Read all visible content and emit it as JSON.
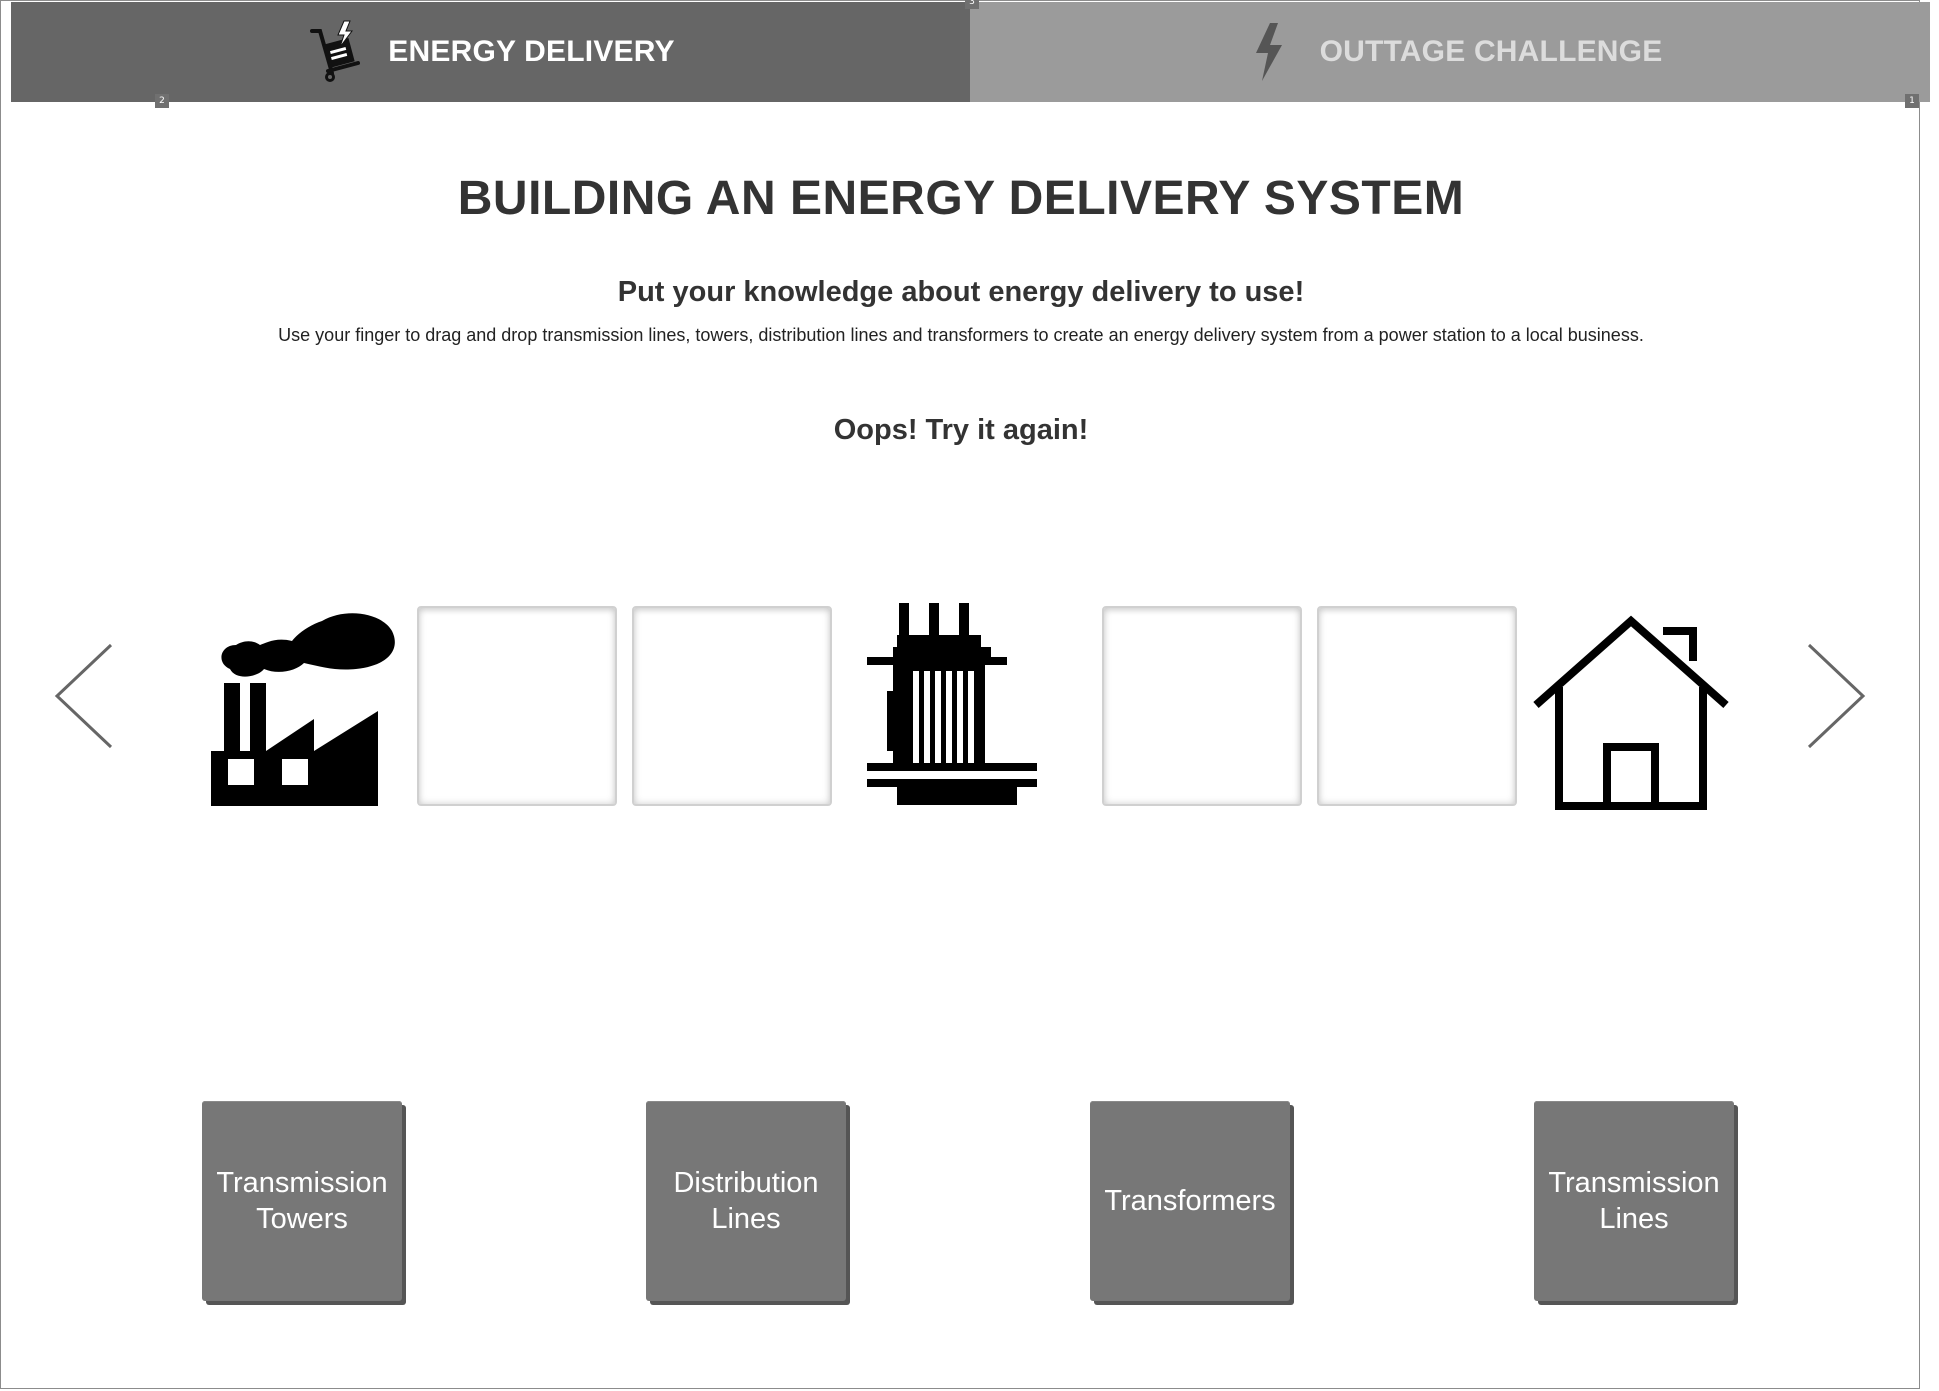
{
  "tabs": [
    {
      "label": "ENERGY DELIVERY",
      "icon": "hand-truck-lightning-icon",
      "active": true
    },
    {
      "label": "OUTTAGE CHALLENGE",
      "icon": "lightning-bolt-icon",
      "active": false
    }
  ],
  "markers": [
    "2",
    "3",
    "1"
  ],
  "content": {
    "title": "BUILDING AN ENERGY DELIVERY SYSTEM",
    "subtitle": "Put your knowledge about energy delivery to use!",
    "instructions": "Use your finger to drag and drop transmission lines, towers, distribution lines and transformers to create an energy delivery system from a power station to a local business.",
    "feedback": "Oops! Try it again!"
  },
  "sequence": [
    {
      "type": "icon",
      "icon": "factory-icon"
    },
    {
      "type": "drop-slot"
    },
    {
      "type": "drop-slot"
    },
    {
      "type": "icon",
      "icon": "transformer-icon"
    },
    {
      "type": "drop-slot"
    },
    {
      "type": "drop-slot"
    },
    {
      "type": "icon",
      "icon": "house-icon"
    }
  ],
  "choices": [
    {
      "label": "Transmission Towers"
    },
    {
      "label": "Distribution Lines"
    },
    {
      "label": "Transformers"
    },
    {
      "label": "Transmission Lines"
    }
  ],
  "colors": {
    "tab_active_bg": "#666666",
    "tab_inactive_bg": "#9b9b9b",
    "choice_bg": "#777777",
    "text_dark": "#333333"
  }
}
